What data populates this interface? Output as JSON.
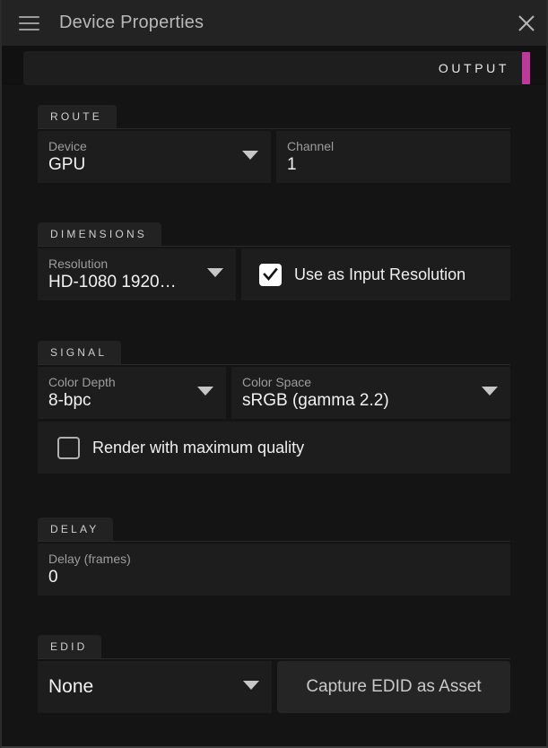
{
  "window": {
    "title": "Device Properties",
    "menu_icon": "hamburger-icon",
    "close_icon": "close-icon",
    "accent_color": "#bf389c",
    "background": "#141414"
  },
  "tabs": [
    {
      "label": "OUTPUT",
      "selected": true
    }
  ],
  "sections": [
    {
      "id": "route",
      "label": "ROUTE",
      "fields": [
        {
          "id": "device",
          "label": "Device",
          "value": "GPU",
          "type": "dropdown"
        },
        {
          "id": "channel",
          "label": "Channel",
          "value": "1",
          "type": "text"
        }
      ]
    },
    {
      "id": "dimensions",
      "label": "DIMENSIONS",
      "fields": [
        {
          "id": "resolution",
          "label": "Resolution",
          "value": "HD-1080 1920…",
          "type": "dropdown"
        },
        {
          "id": "use_as_input_resolution",
          "label": "Use as Input Resolution",
          "checked": true,
          "type": "checkbox"
        }
      ]
    },
    {
      "id": "signal",
      "label": "SIGNAL",
      "fields": [
        {
          "id": "color_depth",
          "label": "Color Depth",
          "value": "8-bpc",
          "type": "dropdown"
        },
        {
          "id": "color_space",
          "label": "Color Space",
          "value": "sRGB (gamma 2.2)",
          "type": "dropdown"
        },
        {
          "id": "render_max_quality",
          "label": "Render with maximum quality",
          "checked": false,
          "type": "checkbox"
        }
      ]
    },
    {
      "id": "delay",
      "label": "DELAY",
      "fields": [
        {
          "id": "delay_frames",
          "label": "Delay (frames)",
          "value": "0",
          "type": "text"
        }
      ]
    },
    {
      "id": "edid",
      "label": "EDID",
      "fields": [
        {
          "id": "edid_select",
          "value": "None",
          "type": "dropdown"
        },
        {
          "id": "capture_edid",
          "label": "Capture EDID as Asset",
          "type": "button"
        }
      ]
    }
  ]
}
